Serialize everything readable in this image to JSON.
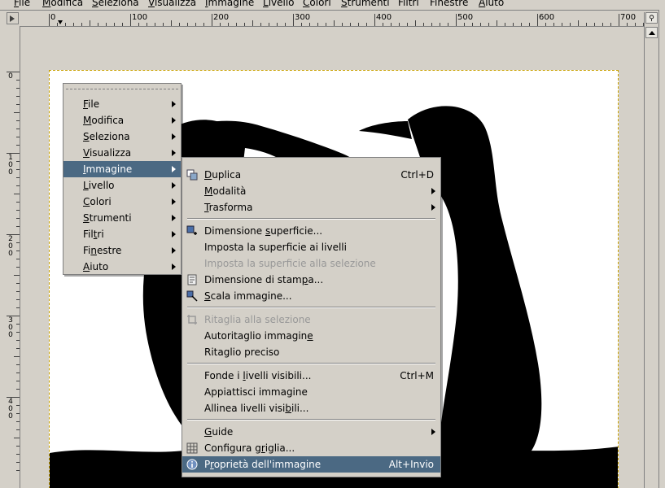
{
  "menubar": [
    {
      "label": "File",
      "mn": "F",
      "rest": "ile"
    },
    {
      "label": "Modifica",
      "mn": "M",
      "rest": "odifica"
    },
    {
      "label": "Seleziona",
      "mn": "S",
      "rest": "eleziona"
    },
    {
      "label": "Visualizza",
      "mn": "V",
      "rest": "isualizza"
    },
    {
      "label": "Immagine",
      "mn": "I",
      "rest": "mmagine"
    },
    {
      "label": "Livello",
      "mn": "L",
      "rest": "ivello"
    },
    {
      "label": "Colori",
      "mn": "C",
      "rest": "olori"
    },
    {
      "label": "Strumenti",
      "mn": "S",
      "rest": "trumenti"
    },
    {
      "label": "Filtri",
      "mn": "",
      "rest": "Filtri"
    },
    {
      "label": "Finestre",
      "mn": "",
      "rest": "Finestre"
    },
    {
      "label": "Aiuto",
      "mn": "A",
      "rest": "iuto"
    }
  ],
  "ruler": {
    "h_labels": [
      "0",
      "100",
      "200",
      "300",
      "400",
      "500",
      "600",
      "700"
    ],
    "v_labels": [
      "0",
      "100",
      "200",
      "300",
      "400"
    ]
  },
  "menu_main": [
    {
      "pre": "",
      "mn": "F",
      "post": "ile",
      "selected": false
    },
    {
      "pre": "",
      "mn": "M",
      "post": "odifica",
      "selected": false
    },
    {
      "pre": "",
      "mn": "S",
      "post": "eleziona",
      "selected": false
    },
    {
      "pre": "",
      "mn": "V",
      "post": "isualizza",
      "selected": false
    },
    {
      "pre": "",
      "mn": "I",
      "post": "mmagine",
      "selected": true
    },
    {
      "pre": "",
      "mn": "L",
      "post": "ivello",
      "selected": false
    },
    {
      "pre": "",
      "mn": "C",
      "post": "olori",
      "selected": false
    },
    {
      "pre": "",
      "mn": "S",
      "post": "trumenti",
      "selected": false
    },
    {
      "pre": "Fil",
      "mn": "t",
      "post": "ri",
      "selected": false
    },
    {
      "pre": "Fi",
      "mn": "n",
      "post": "estre",
      "selected": false
    },
    {
      "pre": "",
      "mn": "A",
      "post": "iuto",
      "selected": false
    }
  ],
  "menu_immagine": [
    {
      "type": "item",
      "pre": "",
      "mn": "D",
      "post": "uplica",
      "acc": "Ctrl+D",
      "icon": "duplicate-icon"
    },
    {
      "type": "item",
      "pre": "",
      "mn": "M",
      "post": "odalità",
      "submenu": true
    },
    {
      "type": "item",
      "pre": "",
      "mn": "T",
      "post": "rasforma",
      "submenu": true
    },
    {
      "type": "sep"
    },
    {
      "type": "item",
      "pre": "Dimensione ",
      "mn": "s",
      "post": "uperficie...",
      "icon": "canvas-size-icon"
    },
    {
      "type": "item",
      "pre": "Imposta",
      "mn": "",
      "post": " la superficie ai livelli"
    },
    {
      "type": "item",
      "pre": "Imposta la superficie alla selezione",
      "mn": "",
      "post": "",
      "disabled": true
    },
    {
      "type": "item",
      "pre": "Dimensione di stam",
      "mn": "p",
      "post": "a...",
      "icon": "print-size-icon"
    },
    {
      "type": "item",
      "pre": "",
      "mn": "S",
      "post": "cala immagine...",
      "icon": "scale-icon"
    },
    {
      "type": "sep"
    },
    {
      "type": "item",
      "pre": "Ritaglia alla selezione",
      "mn": "",
      "post": "",
      "disabled": true,
      "icon": "crop-icon"
    },
    {
      "type": "item",
      "pre": "Autoritaglio immagin",
      "mn": "e",
      "post": ""
    },
    {
      "type": "item",
      "pre": "Ritaglio preciso",
      "mn": "",
      "post": ""
    },
    {
      "type": "sep"
    },
    {
      "type": "item",
      "pre": "Fonde i ",
      "mn": "l",
      "post": "ivelli visibili...",
      "acc": "Ctrl+M"
    },
    {
      "type": "item",
      "pre": "Appiattisci immagine",
      "mn": "",
      "post": ""
    },
    {
      "type": "item",
      "pre": "Allinea livelli visi",
      "mn": "b",
      "post": "ili..."
    },
    {
      "type": "sep"
    },
    {
      "type": "item",
      "pre": "",
      "mn": "G",
      "post": "uide",
      "submenu": true
    },
    {
      "type": "item",
      "pre": "Configura g",
      "mn": "r",
      "post": "iglia...",
      "icon": "grid-icon"
    },
    {
      "type": "item",
      "pre": "P",
      "mn": "r",
      "post": "oprietà dell'immagine",
      "acc": "Alt+Invio",
      "icon": "info-icon",
      "selected": true
    }
  ],
  "colors": {
    "selection": "#4b6983",
    "menu_bg": "#d4d0c8"
  }
}
